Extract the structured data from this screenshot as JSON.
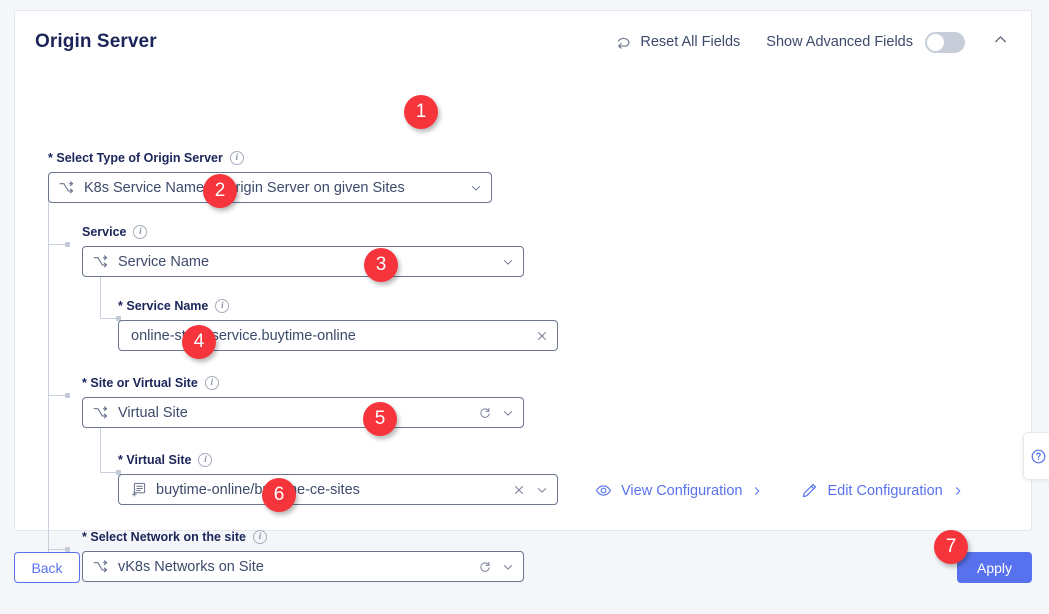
{
  "card": {
    "title": "Origin Server",
    "reset_label": "Reset All Fields",
    "advanced_label": "Show Advanced Fields",
    "advanced_toggle_state": "off",
    "collapse_icon": "chevron-up-icon",
    "reset_icon": "reset-arrow-icon"
  },
  "fields": {
    "origin_type": {
      "label": "Select Type of Origin Server",
      "required": "*",
      "value": "K8s Service Name of Origin Server on given Sites",
      "lead_icon": "shuffle-icon",
      "chevron": "chevron-down-icon"
    },
    "service": {
      "label": "Service",
      "required": "",
      "value": "Service Name",
      "lead_icon": "shuffle-icon",
      "chevron": "chevron-down-icon"
    },
    "service_name": {
      "label": "Service Name",
      "required": "*",
      "value": "online-store-service.buytime-online",
      "clear_icon": "close-icon"
    },
    "site_or_virtual_site": {
      "label": "Site or Virtual Site",
      "required": "*",
      "value": "Virtual Site",
      "lead_icon": "shuffle-icon",
      "refresh_icon": "refresh-icon",
      "chevron": "chevron-down-icon"
    },
    "virtual_site": {
      "label": "Virtual Site",
      "required": "*",
      "value": "buytime-online/buytime-ce-sites",
      "lead_icon": "list-add-icon",
      "clear_icon": "close-icon",
      "chevron": "chevron-down-icon"
    },
    "network_on_site": {
      "label": "Select Network on the site",
      "required": "*",
      "value": "vK8s Networks on Site",
      "lead_icon": "shuffle-icon",
      "refresh_icon": "refresh-icon",
      "chevron": "chevron-down-icon"
    }
  },
  "config_links": {
    "view": {
      "label": "View Configuration",
      "icon": "eye-icon",
      "arrow": "chevron-right-icon"
    },
    "edit": {
      "label": "Edit Configuration",
      "icon": "pencil-icon",
      "arrow": "chevron-right-icon"
    }
  },
  "footer": {
    "back_label": "Back",
    "apply_label": "Apply"
  },
  "help": {
    "icon": "question-circle-icon"
  },
  "badges": [
    {
      "n": "1"
    },
    {
      "n": "2"
    },
    {
      "n": "3"
    },
    {
      "n": "4"
    },
    {
      "n": "5"
    },
    {
      "n": "6"
    },
    {
      "n": "7"
    }
  ],
  "colors": {
    "accent": "#5872ef",
    "badge": "#f5343b",
    "title": "#1b2559",
    "border": "#6b7590"
  }
}
